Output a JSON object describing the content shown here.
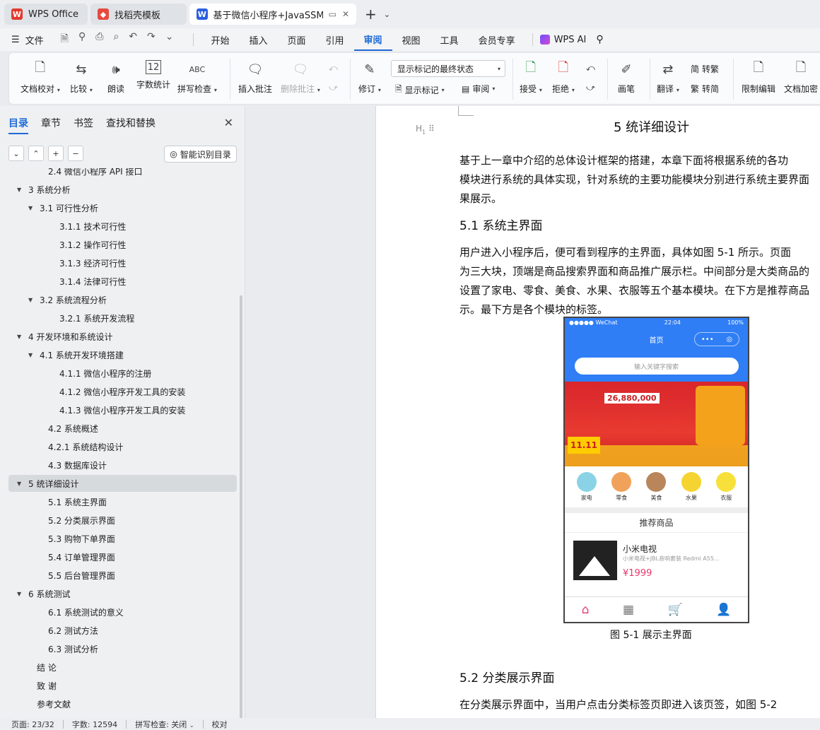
{
  "tabs": [
    {
      "label": "WPS Office",
      "icon": "wps-logo-icon",
      "color": "#e23a2e"
    },
    {
      "label": "找稻壳模板",
      "icon": "docer-logo-icon",
      "color": "#e8493f"
    },
    {
      "label": "基于微信小程序+JavaSSM+M",
      "icon": "word-doc-icon",
      "color": "#2b5fe0"
    }
  ],
  "menu": {
    "file": "文件",
    "items": [
      "开始",
      "插入",
      "页面",
      "引用",
      "审阅",
      "视图",
      "工具",
      "会员专享"
    ],
    "active": "审阅",
    "ai": "WPS AI"
  },
  "ribbon": {
    "doc_check": "文档校对",
    "compare": "比较",
    "read_aloud": "朗读",
    "word_count": "字数统计",
    "spell_check": "拼写检查",
    "insert_comment": "插入批注",
    "delete_comment": "删除批注",
    "revise": "修订",
    "display_state": "显示标记的最终状态",
    "show_markup": "显示标记",
    "review": "审阅",
    "accept": "接受",
    "reject": "拒绝",
    "pen": "画笔",
    "translate": "翻译",
    "to_traditional": "转繁",
    "to_simplified": "转简",
    "restrict_edit": "限制编辑",
    "doc_encrypt": "文档加密"
  },
  "nav": {
    "tabs": [
      "目录",
      "章节",
      "书签",
      "查找和替换"
    ],
    "active_tab": "目录",
    "smart_button": "智能识别目录",
    "toc": [
      {
        "label": "2.4 微信小程序 API 接口",
        "level": 2,
        "arrow": false
      },
      {
        "label": "3  系统分析",
        "level": 1,
        "arrow": true
      },
      {
        "label": "3.1  可行性分析",
        "level": 2,
        "arrow": true
      },
      {
        "label": "3.1.1  技术可行性",
        "level": 3,
        "arrow": false
      },
      {
        "label": "3.1.2 操作可行性",
        "level": 3,
        "arrow": false
      },
      {
        "label": "3.1.3  经济可行性",
        "level": 3,
        "arrow": false
      },
      {
        "label": "3.1.4  法律可行性",
        "level": 3,
        "arrow": false
      },
      {
        "label": "3.2 系统流程分析",
        "level": 2,
        "arrow": true
      },
      {
        "label": "3.2.1 系统开发流程",
        "level": 3,
        "arrow": false
      },
      {
        "label": "4  开发环境和系统设计",
        "level": 1,
        "arrow": true
      },
      {
        "label": "4.1 系统开发环境搭建",
        "level": 2,
        "arrow": true
      },
      {
        "label": "4.1.1    微信小程序的注册",
        "level": 3,
        "arrow": false
      },
      {
        "label": "4.1.2  微信小程序开发工具的安装",
        "level": 3,
        "arrow": false
      },
      {
        "label": "4.1.3  微信小程序开发工具的安装",
        "level": 3,
        "arrow": false
      },
      {
        "label": "4.2  系统概述",
        "level": 2,
        "arrow": false
      },
      {
        "label": "4.2.1  系统结构设计",
        "level": 2,
        "arrow": false
      },
      {
        "label": "4.3 数据库设计",
        "level": 2,
        "arrow": false
      },
      {
        "label": "5 统详细设计",
        "level": 1,
        "arrow": true,
        "selected": true
      },
      {
        "label": "5.1 系统主界面",
        "level": 2,
        "arrow": false
      },
      {
        "label": "5.2 分类展示界面",
        "level": 2,
        "arrow": false
      },
      {
        "label": "5.3 购物下单界面",
        "level": 2,
        "arrow": false
      },
      {
        "label": "5.4 订单管理界面",
        "level": 2,
        "arrow": false
      },
      {
        "label": "5.5 后台管理界面",
        "level": 2,
        "arrow": false
      },
      {
        "label": "6 系统测试",
        "level": 1,
        "arrow": true
      },
      {
        "label": "6.1 系统测试的意义",
        "level": 2,
        "arrow": false
      },
      {
        "label": "6.2  测试方法",
        "level": 2,
        "arrow": false
      },
      {
        "label": "6.3 测试分析",
        "level": 2,
        "arrow": false
      },
      {
        "label": "结     论",
        "level": 1,
        "arrow": false
      },
      {
        "label": "致     谢",
        "level": 1,
        "arrow": false
      },
      {
        "label": "参考文献",
        "level": 1,
        "arrow": false
      }
    ]
  },
  "doc": {
    "heading_marker": "H",
    "h1": "5 统详细设计",
    "intro_lines": [
      "        基于上一章中介绍的总体设计框架的搭建，本章下面将根据系统的各功",
      "模块进行系统的具体实现，针对系统的主要功能模块分别进行系统主要界面",
      "果展示。"
    ],
    "h2_1": "5.1 系统主界面",
    "p2_lines": [
      "        用户进入小程序后，便可看到程序的主界面，具体如图 5-1 所示。页面",
      "为三大块，顶端是商品搜索界面和商品推广展示栏。中间部分是大类商品的",
      "设置了家电、零食、美食、水果、衣服等五个基本模块。在下方是推荐商品",
      "示。最下方是各个模块的标签。"
    ],
    "caption": "图 5-1  展示主界面",
    "h2_2": "5.2 分类展示界面",
    "p3_line": "        在分类展示界面中，当用户点击分类标签页即进入该页签，如图 5-2"
  },
  "phone": {
    "carrier": "●●●●● WeChat",
    "time": "22:04",
    "battery": "100%",
    "title": "首页",
    "search_placeholder": "输入关键字搜索",
    "banner_amount": "26,880,000",
    "banner_1111": "11.11",
    "categories": [
      {
        "label": "家电",
        "color": "#8ad3e6"
      },
      {
        "label": "零食",
        "color": "#f0a25a"
      },
      {
        "label": "美食",
        "color": "#b8865a"
      },
      {
        "label": "水果",
        "color": "#f5d431"
      },
      {
        "label": "衣服",
        "color": "#f7e03a"
      }
    ],
    "recommend": "推荐商品",
    "product_name": "小米电视",
    "product_desc": "小米电视+JBL音响套装 Redmi A55...",
    "product_price": "¥1999"
  },
  "status": {
    "page": "页面: 23/32",
    "words": "字数: 12594",
    "spell": "拼写检查: 关闭",
    "proof": "校对"
  }
}
